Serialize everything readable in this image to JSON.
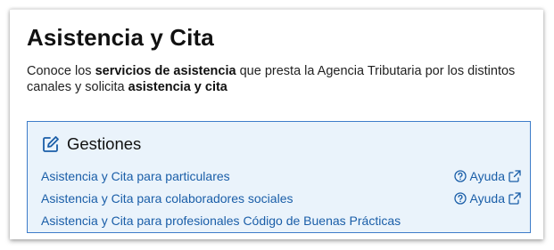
{
  "page": {
    "title": "Asistencia y Cita",
    "intro": {
      "part1": "Conoce los ",
      "bold1": "servicios de asistencia",
      "part2": " que presta la Agencia Tributaria por los distintos canales y solicita ",
      "bold2": "asistencia y cita"
    }
  },
  "gestiones": {
    "heading": "Gestiones",
    "icon": "edit-icon",
    "links": [
      {
        "label": "Asistencia y Cita para particulares",
        "help": "Ayuda"
      },
      {
        "label": "Asistencia y Cita para colaboradores sociales",
        "help": "Ayuda"
      },
      {
        "label": "Asistencia y Cita para profesionales Código de Buenas Prácticas"
      }
    ]
  },
  "colors": {
    "link": "#1a5ea8",
    "box_background": "#eaf3fb",
    "box_border": "#3d7cc9"
  }
}
